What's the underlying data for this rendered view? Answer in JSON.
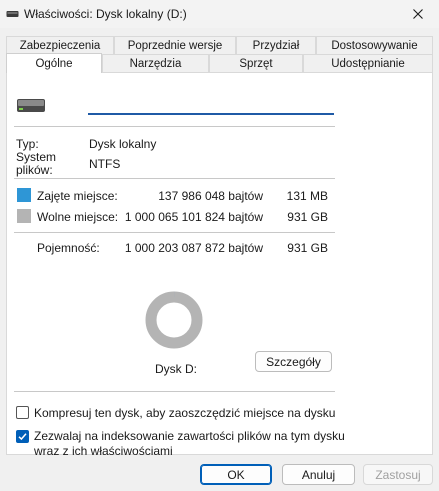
{
  "window": {
    "title": "Właściwości: Dysk lokalny (D:)",
    "title_icon": "drive-icon",
    "close_icon": "close-icon"
  },
  "tabs": {
    "row1": [
      "Zabezpieczenia",
      "Poprzednie wersje",
      "Przydział",
      "Dostosowywanie"
    ],
    "row2": [
      "Ogólne",
      "Narzędzia",
      "Sprzęt",
      "Udostępnianie"
    ],
    "active": "Ogólne"
  },
  "general": {
    "name_value": "",
    "type_label": "Typ:",
    "type_value": "Dysk lokalny",
    "fs_label_line1": "System",
    "fs_label_line2": "plików:",
    "fs_value": "NTFS",
    "used_label": "Zajęte miejsce:",
    "used_bytes": "137 986 048 bajtów",
    "used_size": "131 MB",
    "used_color": "#2e96d6",
    "free_label": "Wolne miejsce:",
    "free_bytes": "1 000 065 101 824 bajtów",
    "free_size": "931 GB",
    "free_color": "#b4b4b4",
    "capacity_label": "Pojemność:",
    "capacity_bytes": "1 000 203 087 872 bajtów",
    "capacity_size": "931 GB",
    "used_fraction": 0.000138,
    "drive_label": "Dysk D:",
    "details_button": "Szczegóły",
    "compress_label": "Kompresuj ten dysk, aby zaoszczędzić miejsce na dysku",
    "compress_checked": false,
    "index_label_line1": "Zezwalaj na indeksowanie zawartości plików na tym dysku",
    "index_label_line2": "wraz z ich właściwościami",
    "index_checked": true
  },
  "buttons": {
    "ok": "OK",
    "cancel": "Anuluj",
    "apply": "Zastosuj"
  }
}
